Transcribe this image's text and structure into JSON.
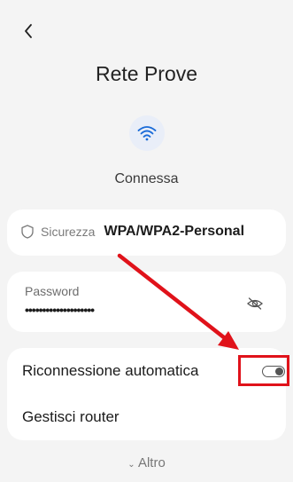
{
  "header": {
    "back_icon": "chevron-left-icon",
    "title": "Rete Prove"
  },
  "connection": {
    "icon": "wifi-icon",
    "status": "Connessa",
    "accent": "#1a6bd8"
  },
  "security": {
    "icon": "shield-icon",
    "label": "Sicurezza",
    "value": "WPA/WPA2-Personal"
  },
  "password": {
    "label": "Password",
    "masked_value": "••••••••••••••••••••",
    "visibility_icon": "eye-off-icon"
  },
  "options": {
    "auto_reconnect": {
      "label": "Riconnessione automatica",
      "enabled": false
    },
    "manage_router": {
      "label": "Gestisci router"
    }
  },
  "more": {
    "label": "Altro",
    "icon": "chevron-down-icon"
  },
  "annotation": {
    "color": "#e0121a"
  }
}
